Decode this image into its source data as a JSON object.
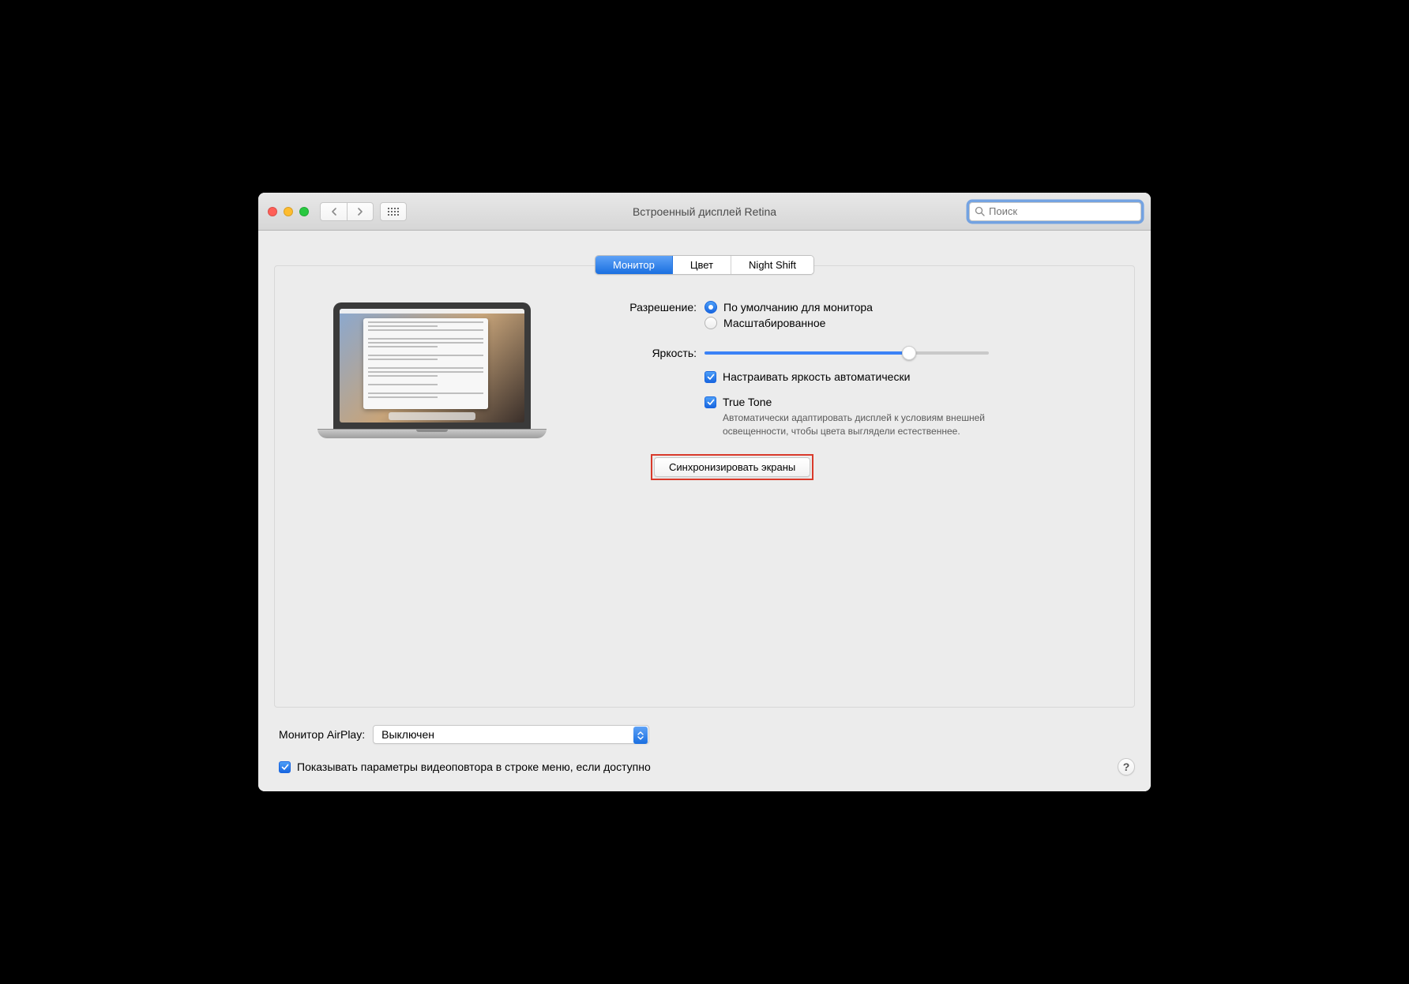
{
  "window": {
    "title": "Встроенный дисплей Retina",
    "search_placeholder": "Поиск"
  },
  "tabs": {
    "monitor": "Монитор",
    "color": "Цвет",
    "night_shift": "Night Shift",
    "active": "monitor"
  },
  "resolution": {
    "label": "Разрешение:",
    "default_label": "По умолчанию для монитора",
    "scaled_label": "Масштабированное",
    "selected": "default"
  },
  "brightness": {
    "label": "Яркость:",
    "value_percent": 72,
    "auto_label": "Настраивать яркость автоматически",
    "auto_checked": true
  },
  "truetone": {
    "label": "True Tone",
    "checked": true,
    "description": "Автоматически адаптировать дисплей к условиям внешней освещенности, чтобы цвета выглядели естественнее."
  },
  "gather": {
    "button_label": "Синхронизировать экраны"
  },
  "airplay": {
    "label": "Монитор AirPlay:",
    "value": "Выключен"
  },
  "mirroring": {
    "label": "Показывать параметры видеоповтора в строке меню, если доступно",
    "checked": true
  },
  "help_label": "?"
}
